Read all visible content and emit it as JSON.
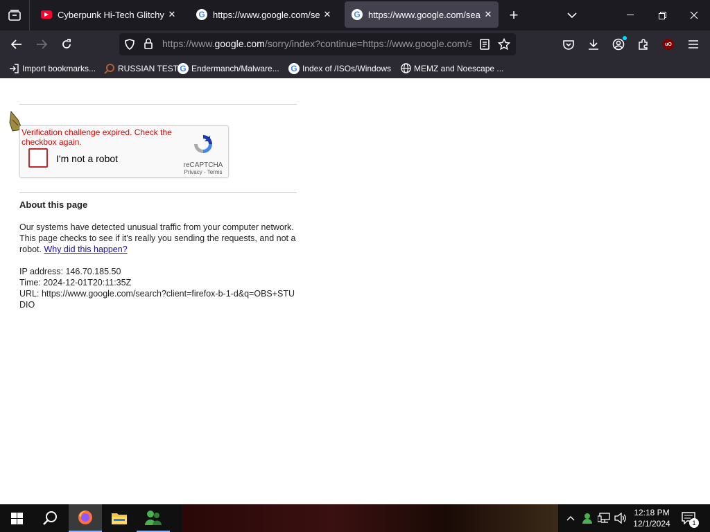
{
  "tabs": [
    {
      "title": "Cyberpunk Hi-Tech Glitchy Neon",
      "icon": "youtube-icon",
      "active": false
    },
    {
      "title": "https://www.google.com/search",
      "icon": "google-icon",
      "active": false
    },
    {
      "title": "https://www.google.com/search",
      "icon": "google-icon",
      "active": true
    }
  ],
  "tab_close_glyph": "✕",
  "new_tab_glyph": "+",
  "url": {
    "prefix": "https://www.",
    "host": "google.com",
    "rest": "/sorry/index?continue=https://www.google.com/search"
  },
  "bookmarks": [
    {
      "label": "Import bookmarks...",
      "icon": "import-icon"
    },
    {
      "label": "RUSSIAN TEST",
      "icon": "magnifier-icon"
    },
    {
      "label": "Endermanch/Malware...",
      "icon": "google-icon"
    },
    {
      "label": "Index of /ISOs/Windows",
      "icon": "google-icon"
    },
    {
      "label": "MEMZ and Noescape ...",
      "icon": "globe-icon"
    }
  ],
  "captcha": {
    "error": "Verification challenge expired. Check the checkbox again.",
    "label": "I'm not a robot",
    "brand": "reCAPTCHA",
    "privacy": "Privacy",
    "sep": " - ",
    "terms": "Terms"
  },
  "about": {
    "heading": "About this page",
    "paragraph": "Our systems have detected unusual traffic from your computer network. This page checks to see if it's really you sending the requests, and not a robot.",
    "link": "Why did this happen?",
    "ip_label": "IP address: ",
    "ip": "146.70.185.50",
    "time_label": "Time: ",
    "time": "2024-12-01T20:11:35Z",
    "url_label": "URL: ",
    "url": "https://www.google.com/search?client=firefox-b-1-d&q=OBS+STUDIO"
  },
  "taskbar": {
    "time": "12:18 PM",
    "date": "12/1/2024",
    "notifications": "1"
  },
  "colors": {
    "browser_dark": "#1c1b22",
    "toolbar": "#2b2a33",
    "error": "#dd0000",
    "link": "#1a0dab"
  }
}
